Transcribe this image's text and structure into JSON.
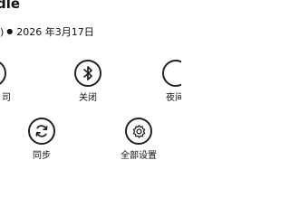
{
  "header": {
    "title_partial": "dle",
    "status_partial": ")",
    "date": "2026 年3月17日"
  },
  "controls": [
    {
      "id": "left-top",
      "icon": "partial-circle-icon",
      "label_partial": "司"
    },
    {
      "id": "bluetooth",
      "icon": "bluetooth-icon",
      "label": "关闭"
    },
    {
      "id": "night-mode",
      "icon": "partial-circle-icon",
      "label_partial": "夜间"
    },
    {
      "id": "sync",
      "icon": "sync-icon",
      "label": "同步"
    },
    {
      "id": "all-settings",
      "icon": "gear-icon",
      "label": "全部设置"
    }
  ]
}
